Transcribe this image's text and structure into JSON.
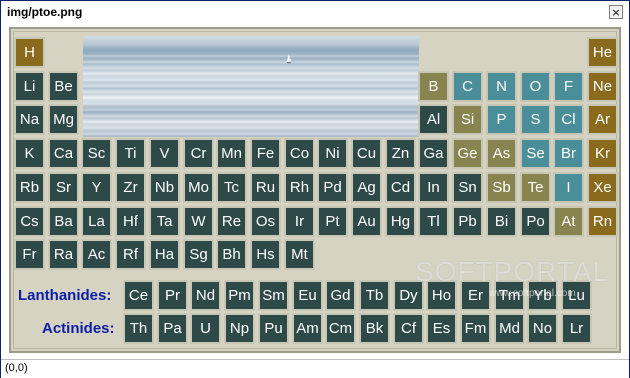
{
  "window": {
    "title": "img/ptoe.png",
    "close_label": "×"
  },
  "status": {
    "text": "(0,0)"
  },
  "labels": {
    "lanthanides": "Lanthanides:",
    "actinides": "Actinides:"
  },
  "watermark": {
    "text": "SOFTPORTAL",
    "sub": "www.softportal.com"
  },
  "colors": {
    "dark": "#2e4a48",
    "gold": "#8a6a1c",
    "khaki": "#888450",
    "teal": "#4a8e9a",
    "label_blue": "#0c1ea8"
  },
  "elements": [
    {
      "s": "H",
      "c": "gold"
    },
    {
      "s": "He",
      "c": "gold"
    },
    {
      "s": "Li",
      "c": "dark"
    },
    {
      "s": "Be",
      "c": "dark"
    },
    {
      "s": "B",
      "c": "khaki"
    },
    {
      "s": "C",
      "c": "teal"
    },
    {
      "s": "N",
      "c": "teal"
    },
    {
      "s": "O",
      "c": "teal"
    },
    {
      "s": "F",
      "c": "teal"
    },
    {
      "s": "Ne",
      "c": "gold"
    },
    {
      "s": "Na",
      "c": "dark"
    },
    {
      "s": "Mg",
      "c": "dark"
    },
    {
      "s": "Al",
      "c": "dark"
    },
    {
      "s": "Si",
      "c": "khaki"
    },
    {
      "s": "P",
      "c": "teal"
    },
    {
      "s": "S",
      "c": "teal"
    },
    {
      "s": "Cl",
      "c": "teal"
    },
    {
      "s": "Ar",
      "c": "gold"
    },
    {
      "s": "K",
      "c": "dark"
    },
    {
      "s": "Ca",
      "c": "dark"
    },
    {
      "s": "Sc",
      "c": "dark"
    },
    {
      "s": "Ti",
      "c": "dark"
    },
    {
      "s": "V",
      "c": "dark"
    },
    {
      "s": "Cr",
      "c": "dark"
    },
    {
      "s": "Mn",
      "c": "dark"
    },
    {
      "s": "Fe",
      "c": "dark"
    },
    {
      "s": "Co",
      "c": "dark"
    },
    {
      "s": "Ni",
      "c": "dark"
    },
    {
      "s": "Cu",
      "c": "dark"
    },
    {
      "s": "Zn",
      "c": "dark"
    },
    {
      "s": "Ga",
      "c": "dark"
    },
    {
      "s": "Ge",
      "c": "khaki"
    },
    {
      "s": "As",
      "c": "khaki"
    },
    {
      "s": "Se",
      "c": "teal"
    },
    {
      "s": "Br",
      "c": "teal"
    },
    {
      "s": "Kr",
      "c": "gold"
    },
    {
      "s": "Rb",
      "c": "dark"
    },
    {
      "s": "Sr",
      "c": "dark"
    },
    {
      "s": "Y",
      "c": "dark"
    },
    {
      "s": "Zr",
      "c": "dark"
    },
    {
      "s": "Nb",
      "c": "dark"
    },
    {
      "s": "Mo",
      "c": "dark"
    },
    {
      "s": "Tc",
      "c": "dark"
    },
    {
      "s": "Ru",
      "c": "dark"
    },
    {
      "s": "Rh",
      "c": "dark"
    },
    {
      "s": "Pd",
      "c": "dark"
    },
    {
      "s": "Ag",
      "c": "dark"
    },
    {
      "s": "Cd",
      "c": "dark"
    },
    {
      "s": "In",
      "c": "dark"
    },
    {
      "s": "Sn",
      "c": "dark"
    },
    {
      "s": "Sb",
      "c": "khaki"
    },
    {
      "s": "Te",
      "c": "khaki"
    },
    {
      "s": "I",
      "c": "teal"
    },
    {
      "s": "Xe",
      "c": "gold"
    },
    {
      "s": "Cs",
      "c": "dark"
    },
    {
      "s": "Ba",
      "c": "dark"
    },
    {
      "s": "La",
      "c": "dark"
    },
    {
      "s": "Hf",
      "c": "dark"
    },
    {
      "s": "Ta",
      "c": "dark"
    },
    {
      "s": "W",
      "c": "dark"
    },
    {
      "s": "Re",
      "c": "dark"
    },
    {
      "s": "Os",
      "c": "dark"
    },
    {
      "s": "Ir",
      "c": "dark"
    },
    {
      "s": "Pt",
      "c": "dark"
    },
    {
      "s": "Au",
      "c": "dark"
    },
    {
      "s": "Hg",
      "c": "dark"
    },
    {
      "s": "Tl",
      "c": "dark"
    },
    {
      "s": "Pb",
      "c": "dark"
    },
    {
      "s": "Bi",
      "c": "dark"
    },
    {
      "s": "Po",
      "c": "dark"
    },
    {
      "s": "At",
      "c": "khaki"
    },
    {
      "s": "Rn",
      "c": "gold"
    },
    {
      "s": "Fr",
      "c": "dark"
    },
    {
      "s": "Ra",
      "c": "dark"
    },
    {
      "s": "Ac",
      "c": "dark"
    },
    {
      "s": "Rf",
      "c": "dark"
    },
    {
      "s": "Ha",
      "c": "dark"
    },
    {
      "s": "Sg",
      "c": "dark"
    },
    {
      "s": "Bh",
      "c": "dark"
    },
    {
      "s": "Hs",
      "c": "dark"
    },
    {
      "s": "Mt",
      "c": "dark"
    }
  ],
  "lanthanides": [
    "Ce",
    "Pr",
    "Nd",
    "Pm",
    "Sm",
    "Eu",
    "Gd",
    "Tb",
    "Dy",
    "Ho",
    "Er",
    "Tm",
    "Yb",
    "Lu"
  ],
  "actinides": [
    "Th",
    "Pa",
    "U",
    "Np",
    "Pu",
    "Am",
    "Cm",
    "Bk",
    "Cf",
    "Es",
    "Fm",
    "Md",
    "No",
    "Lr"
  ]
}
